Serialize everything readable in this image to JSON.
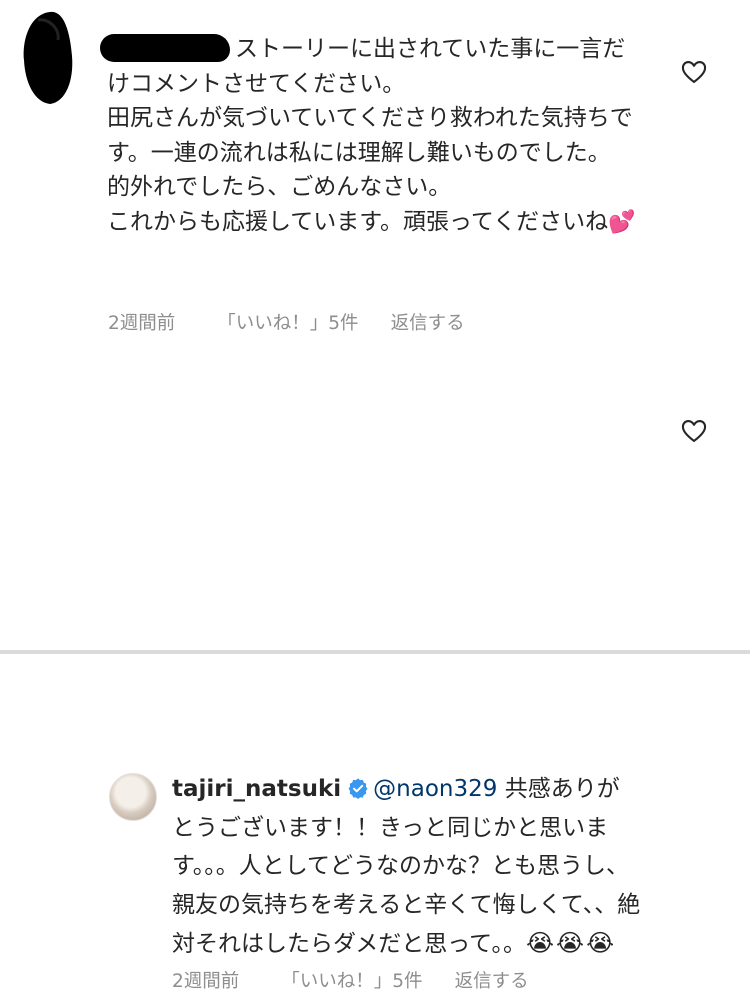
{
  "comment1": {
    "username_redacted": true,
    "paragraphs": [
      "ストーリーに出されていた事に一言だけコメントさせてください。",
      "田尻さんが気づいていてくださり救われた気持ちです。一連の流れは私には理解し難いものでした。",
      "的外れでしたら、ごめんなさい。",
      "これからも応援しています。頑張ってくださいね"
    ],
    "emoji": "💕",
    "time": "2週間前",
    "likes": "「いいね！」5件",
    "reply": "返信する"
  },
  "comment2": {
    "username": "tajiri_natsuki",
    "mention": "@naon329",
    "text": " 共感ありがとうございます！！きっと同じかと思います。。。人としてどうなのかな？とも思うし、親友の気持ちを考えると辛くて悔しくて、、絶対それはしたらダメだと思って。。",
    "emoji": "😭😭😭",
    "time": "2週間前",
    "likes": "「いいね！」5件",
    "reply": "返信する"
  },
  "icons": {
    "like": "heart-outline-icon",
    "verified": "verified-badge-icon"
  },
  "colors": {
    "text": "#262626",
    "meta": "#8e8e8e",
    "mention": "#00376b",
    "verified": "#3897f0"
  }
}
